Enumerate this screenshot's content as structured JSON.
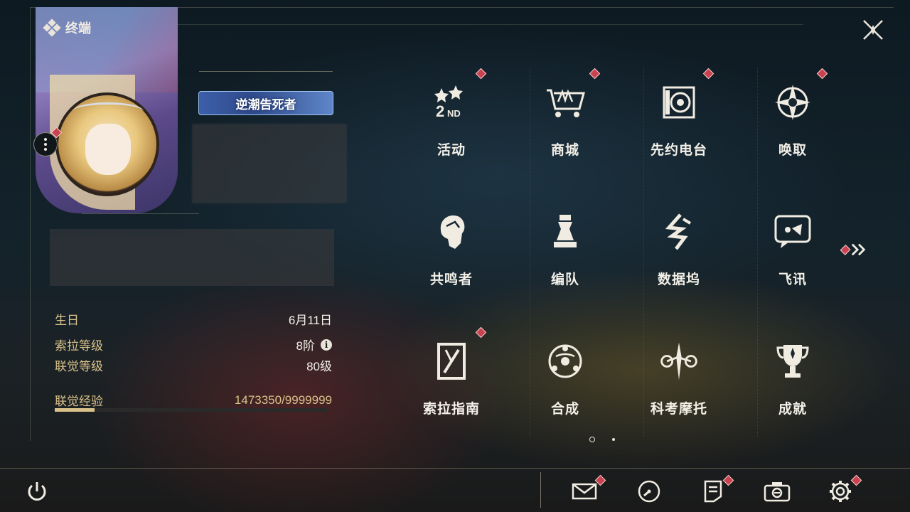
{
  "header": {
    "title": "终端"
  },
  "profile": {
    "title_badge": "逆潮告死者",
    "info": [
      {
        "label": "生日",
        "value": "6月11日"
      },
      {
        "label": "索拉等级",
        "value": "8阶",
        "icon": "info-icon"
      },
      {
        "label": "联觉等级",
        "value": "80级"
      }
    ],
    "exp": {
      "label": "联觉经验",
      "value": "1473350/9999999",
      "progress": 0.147
    }
  },
  "menu": {
    "items": [
      {
        "id": "activity",
        "label": "活动",
        "icon": "2nd-anniversary-icon",
        "notify": true
      },
      {
        "id": "shop",
        "label": "商城",
        "icon": "shop-cart-icon",
        "notify": true
      },
      {
        "id": "radio",
        "label": "先约电台",
        "icon": "radio-icon",
        "notify": true
      },
      {
        "id": "summon",
        "label": "唤取",
        "icon": "compass-star-icon",
        "notify": true
      },
      {
        "id": "resonator",
        "label": "共鸣者",
        "icon": "character-head-icon",
        "notify": false
      },
      {
        "id": "team",
        "label": "编队",
        "icon": "chess-team-icon",
        "notify": false
      },
      {
        "id": "databank",
        "label": "数据坞",
        "icon": "databank-icon",
        "notify": false
      },
      {
        "id": "message",
        "label": "飞讯",
        "icon": "message-icon",
        "notify": false
      },
      {
        "id": "guide",
        "label": "索拉指南",
        "icon": "guidebook-icon",
        "notify": true
      },
      {
        "id": "synthesis",
        "label": "合成",
        "icon": "synthesis-icon",
        "notify": false
      },
      {
        "id": "motorcycle",
        "label": "科考摩托",
        "icon": "motorcycle-icon",
        "notify": false
      },
      {
        "id": "achievement",
        "label": "成就",
        "icon": "trophy-icon",
        "notify": false
      }
    ],
    "page_indicator": {
      "current": 1,
      "total": 2
    }
  },
  "bottom_bar": [
    {
      "id": "power",
      "icon": "power-icon",
      "notify": false
    },
    {
      "id": "mail",
      "icon": "mail-icon",
      "notify": true
    },
    {
      "id": "time",
      "icon": "clock-icon",
      "notify": false
    },
    {
      "id": "notice",
      "icon": "notice-icon",
      "notify": true
    },
    {
      "id": "camera",
      "icon": "camera-icon",
      "notify": false
    },
    {
      "id": "settings",
      "icon": "gear-icon",
      "notify": true
    }
  ],
  "colors": {
    "accent": "#d9c28a",
    "notify": "#c8434f",
    "text": "#f3f0e8"
  }
}
